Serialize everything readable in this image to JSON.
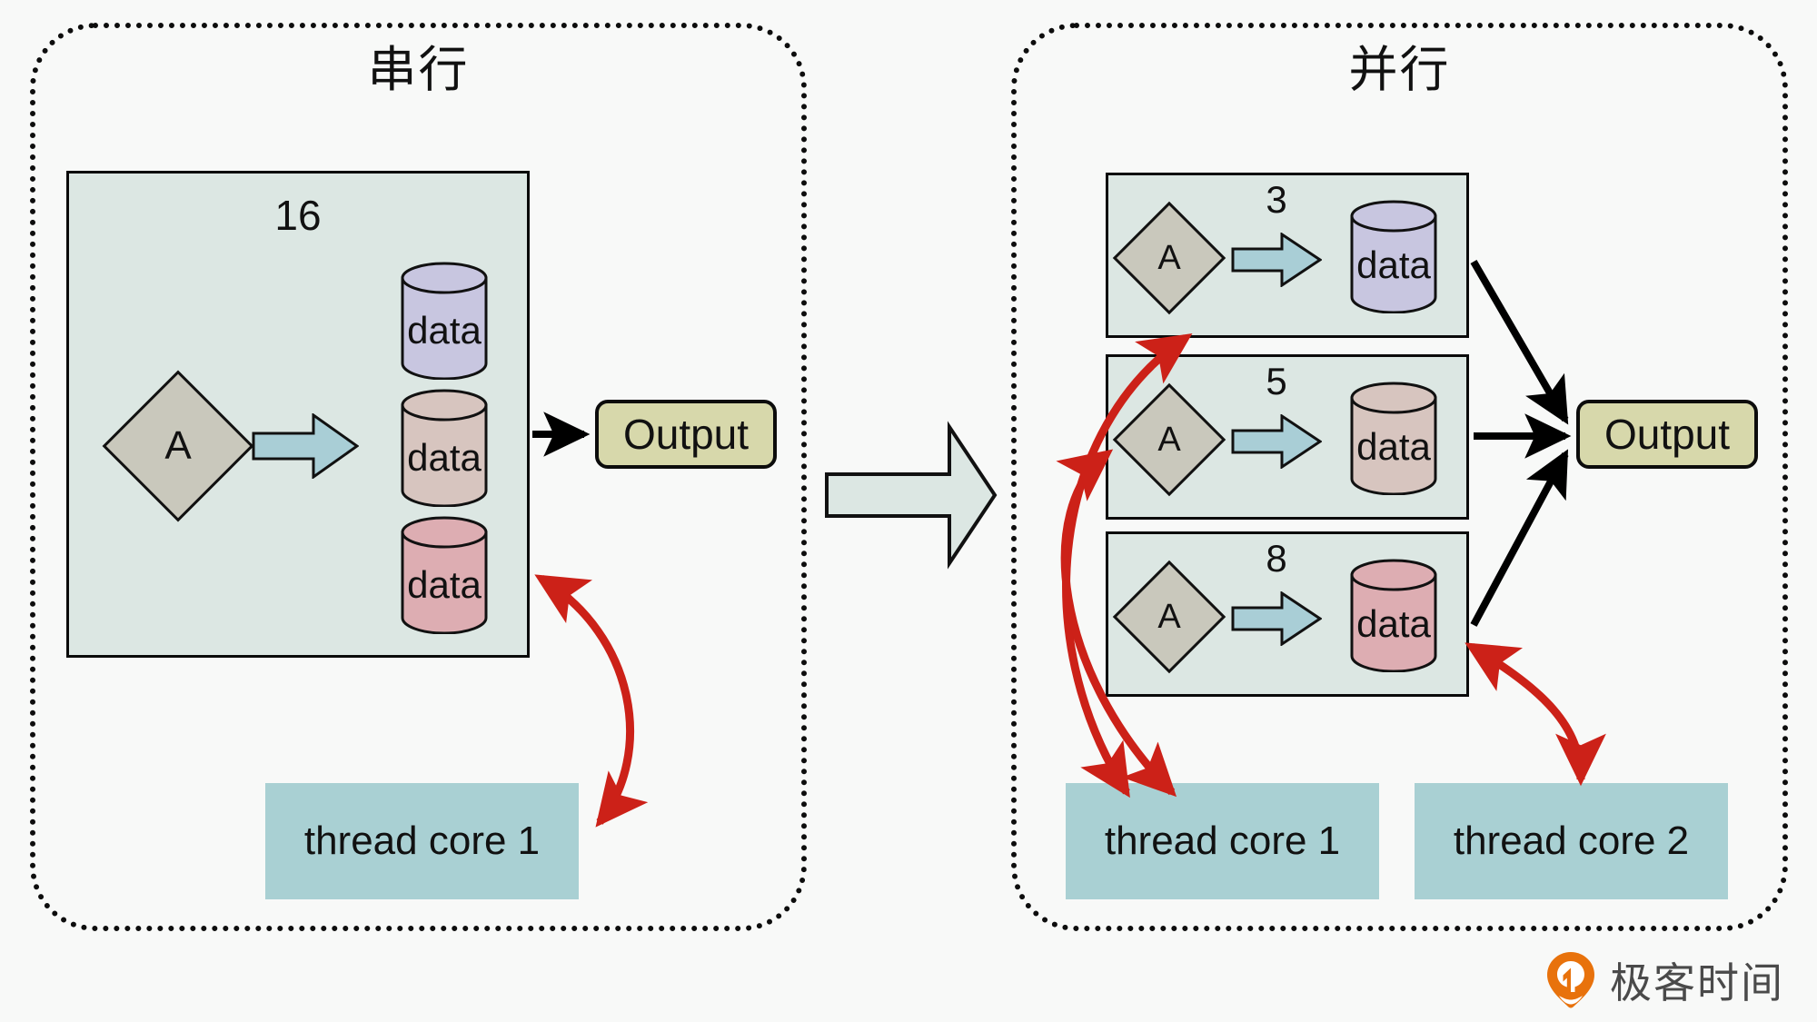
{
  "panels": [
    {
      "id": "serial",
      "title": "串行",
      "group": {
        "number": "16",
        "process_label": "A",
        "datastores": [
          {
            "label": "data",
            "color": "#c8c6e0"
          },
          {
            "label": "data",
            "color": "#d7c5bf"
          },
          {
            "label": "data",
            "color": "#ddadb2"
          }
        ]
      },
      "output_label": "Output",
      "cores": [
        {
          "label": "thread core 1"
        }
      ]
    },
    {
      "id": "parallel",
      "title": "并行",
      "groups": [
        {
          "number": "3",
          "process_label": "A",
          "datastore": {
            "label": "data",
            "color": "#c8c6e0"
          }
        },
        {
          "number": "5",
          "process_label": "A",
          "datastore": {
            "label": "data",
            "color": "#d7c5bf"
          }
        },
        {
          "number": "8",
          "process_label": "A",
          "datastore": {
            "label": "data",
            "color": "#ddadb2"
          }
        }
      ],
      "output_label": "Output",
      "cores": [
        {
          "label": "thread core 1"
        },
        {
          "label": "thread core 2"
        }
      ]
    }
  ],
  "transition_arrow": {
    "name": "big-right-arrow"
  },
  "logo": {
    "text": "极客时间",
    "mark_color": "#e8720c"
  },
  "colors": {
    "group_fill": "#dce7e3",
    "diamond_fill": "#c9c8bc",
    "output_fill": "#d7d8ab",
    "core_fill": "#a9d0d3",
    "blue_arrow_fill": "#a9ced6",
    "red_arrow": "#cc2118",
    "black_arrow": "#000000",
    "background": "#f8f9f8"
  }
}
